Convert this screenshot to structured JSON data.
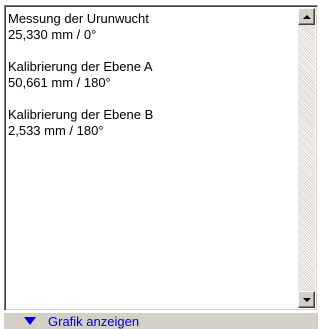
{
  "listbox": {
    "entries": [
      {
        "title": "Messung der Urunwucht",
        "value": "25,330 mm  /  0°"
      },
      {
        "title": "Kalibrierung der Ebene A",
        "value": "50,661 mm  /  180°"
      },
      {
        "title": "Kalibrierung der Ebene B",
        "value": "2,533 mm  /  180°"
      }
    ]
  },
  "scrollbar": {
    "up_icon": "arrow-up-icon",
    "down_icon": "arrow-down-icon"
  },
  "toggle": {
    "label": "Grafik anzeigen",
    "icon": "triangle-down-icon",
    "color": "#0000cc"
  }
}
